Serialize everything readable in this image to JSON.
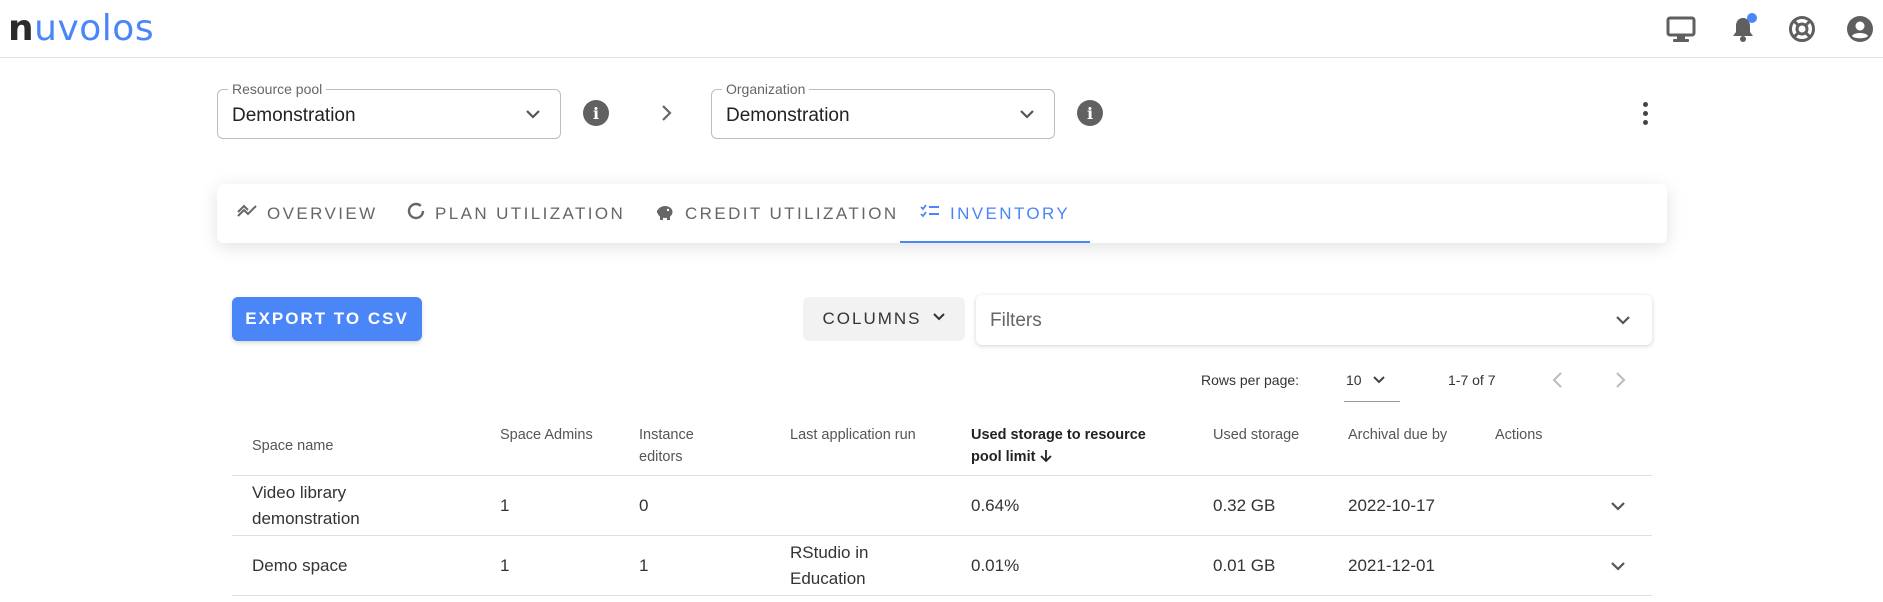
{
  "app": {
    "logo_part1": "n",
    "logo_part2": "uvolos"
  },
  "selectors": {
    "resource_pool": {
      "label": "Resource pool",
      "value": "Demonstration"
    },
    "organization": {
      "label": "Organization",
      "value": "Demonstration"
    }
  },
  "tabs": [
    {
      "label": "OVERVIEW",
      "icon": "trending-icon"
    },
    {
      "label": "PLAN UTILIZATION",
      "icon": "donut-icon"
    },
    {
      "label": "CREDIT UTILIZATION",
      "icon": "piggy-bank-icon"
    },
    {
      "label": "INVENTORY",
      "icon": "checklist-icon",
      "active": true
    }
  ],
  "toolbar": {
    "export_label": "EXPORT TO CSV",
    "columns_label": "COLUMNS",
    "filters_placeholder": "Filters"
  },
  "pagination": {
    "rows_per_page_label": "Rows per page:",
    "rows_per_page": "10",
    "range": "1-7 of 7"
  },
  "table": {
    "headers": {
      "space_name": "Space name",
      "space_admins": "Space Admins",
      "instance_editors_1": "Instance",
      "instance_editors_2": "editors",
      "last_run": "Last application run",
      "used_limit_1": "Used storage to resource",
      "used_limit_2": "pool limit",
      "used_storage": "Used storage",
      "archival": "Archival due by",
      "actions": "Actions"
    },
    "rows": [
      {
        "name_1": "Video library",
        "name_2": "demonstration",
        "admins": "1",
        "editors": "0",
        "last_run_1": "",
        "last_run_2": "",
        "used_pct": "0.64%",
        "used_storage": "0.32 GB",
        "archival": "2022-10-17"
      },
      {
        "name_1": "Demo space",
        "name_2": "",
        "admins": "1",
        "editors": "1",
        "last_run_1": "RStudio in",
        "last_run_2": "Education",
        "used_pct": "0.01%",
        "used_storage": "0.01 GB",
        "archival": "2021-12-01"
      }
    ]
  },
  "colors": {
    "accent": "#4a86f7",
    "icon_dark": "#5f5f5f"
  }
}
